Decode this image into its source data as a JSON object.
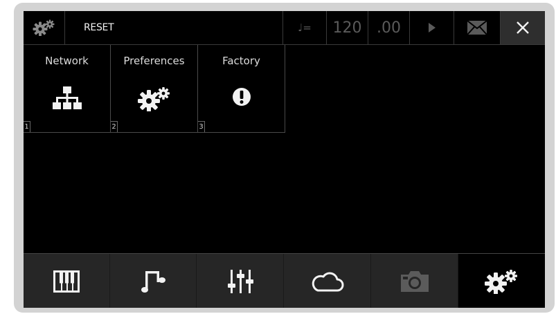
{
  "topbar": {
    "title": "RESET",
    "tempo_symbol": "♩=",
    "tempo_value": "120",
    "tempo_fraction": ".00"
  },
  "tiles": [
    {
      "label": "Network",
      "number": "1",
      "icon": "network-icon"
    },
    {
      "label": "Preferences",
      "number": "2",
      "icon": "gears-icon"
    },
    {
      "label": "Factory",
      "number": "3",
      "icon": "exclamation-icon"
    }
  ],
  "bottom_tabs": [
    {
      "icon": "keyboard-icon",
      "active": false,
      "disabled": false
    },
    {
      "icon": "music-note-icon",
      "active": false,
      "disabled": false
    },
    {
      "icon": "mixer-icon",
      "active": false,
      "disabled": false
    },
    {
      "icon": "cloud-icon",
      "active": false,
      "disabled": false
    },
    {
      "icon": "camera-icon",
      "active": false,
      "disabled": true
    },
    {
      "icon": "settings-gears-icon",
      "active": true,
      "disabled": false
    }
  ],
  "colors": {
    "background": "#000000",
    "frame": "#d3d3d3",
    "tab_bar": "#262626",
    "dim_text": "#5a5a5a",
    "text": "#f2f2f2"
  }
}
